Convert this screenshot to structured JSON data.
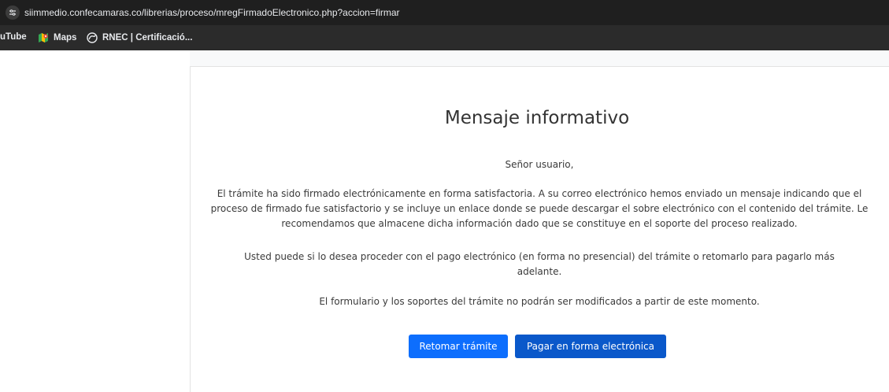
{
  "browser": {
    "url": "siimmedio.confecamaras.co/librerias/proceso/mregFirmadoElectronico.php?accion=firmar",
    "bookmarks": [
      {
        "label": "uTube",
        "icon": "youtube-icon"
      },
      {
        "label": "Maps",
        "icon": "maps-icon"
      },
      {
        "label": "RNEC | Certificació...",
        "icon": "globe-icon"
      }
    ]
  },
  "main": {
    "title": "Mensaje informativo",
    "greeting": "Señor usuario,",
    "paragraph1": "El trámite ha sido firmado electrónicamente en forma satisfactoria. A su correo electrónico hemos enviado un mensaje indicando que el proceso de firmado fue satisfactorio y se incluye un enlace donde se puede descargar el sobre electrónico con el contenido del trámite. Le recomendamos que almacene dicha información dado que se constituye en el soporte del proceso realizado.",
    "paragraph2": "Usted puede si lo desea proceder con el pago electrónico (en forma no presencial) del trámite o retomarlo para pagarlo más adelante.",
    "paragraph3": "El formulario y los soportes del trámite no podrán ser modificados a partir de este momento.",
    "buttons": {
      "retomar": "Retomar trámite",
      "pagar": "Pagar en forma electrónica"
    }
  },
  "colors": {
    "primary": "#0d6efd",
    "primary_dark": "#0a58ca",
    "chrome_dark": "#1f1f1f"
  }
}
